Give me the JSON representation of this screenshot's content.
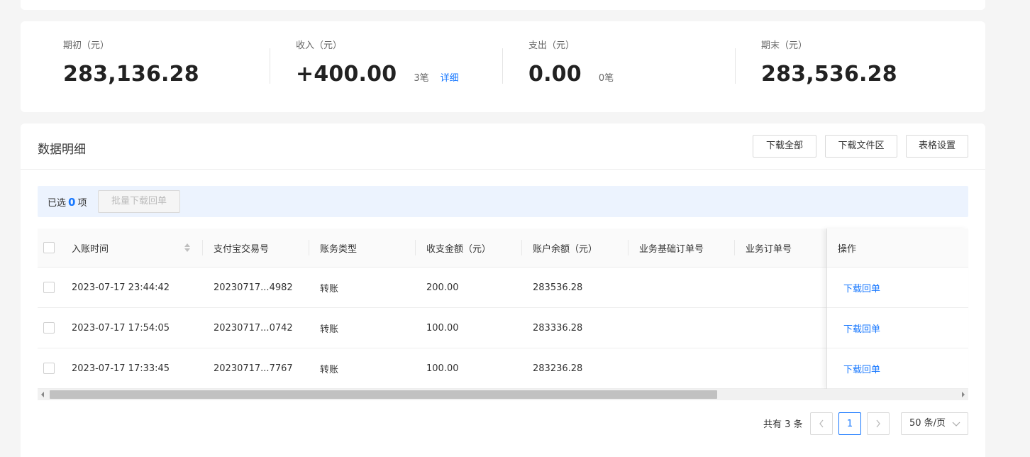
{
  "summary": {
    "opening": {
      "label": "期初（元）",
      "value": "283,136.28"
    },
    "income": {
      "label": "收入（元）",
      "value": "+400.00",
      "count": "3笔",
      "link": "详细"
    },
    "expense": {
      "label": "支出（元）",
      "value": "0.00",
      "count": "0笔"
    },
    "closing": {
      "label": "期末（元）",
      "value": "283,536.28"
    }
  },
  "detail": {
    "title": "数据明细",
    "buttons": {
      "download_all": "下载全部",
      "download_area": "下载文件区",
      "table_settings": "表格设置"
    },
    "selection": {
      "prefix": "已选",
      "count": "0",
      "suffix": "项",
      "batch_button": "批量下载回单"
    },
    "columns": [
      "入账时间",
      "支付宝交易号",
      "账务类型",
      "收支金额（元）",
      "账户余额（元）",
      "业务基础订单号",
      "业务订单号",
      "操作"
    ],
    "rows": [
      {
        "time": "2023-07-17 23:44:42",
        "trade_no": "20230717...4982",
        "type": "转账",
        "amount": "200.00",
        "balance": "283536.28",
        "action": "下载回单"
      },
      {
        "time": "2023-07-17 17:54:05",
        "trade_no": "20230717...0742",
        "type": "转账",
        "amount": "100.00",
        "balance": "283336.28",
        "action": "下载回单"
      },
      {
        "time": "2023-07-17 17:33:45",
        "trade_no": "20230717...7767",
        "type": "转账",
        "amount": "100.00",
        "balance": "283236.28",
        "action": "下载回单"
      }
    ]
  },
  "pagination": {
    "total_text": "共有 3 条",
    "current_page": "1",
    "page_size": "50 条/页"
  },
  "colors": {
    "accent": "#1677ff",
    "selection_bg": "#ecf3fe"
  }
}
